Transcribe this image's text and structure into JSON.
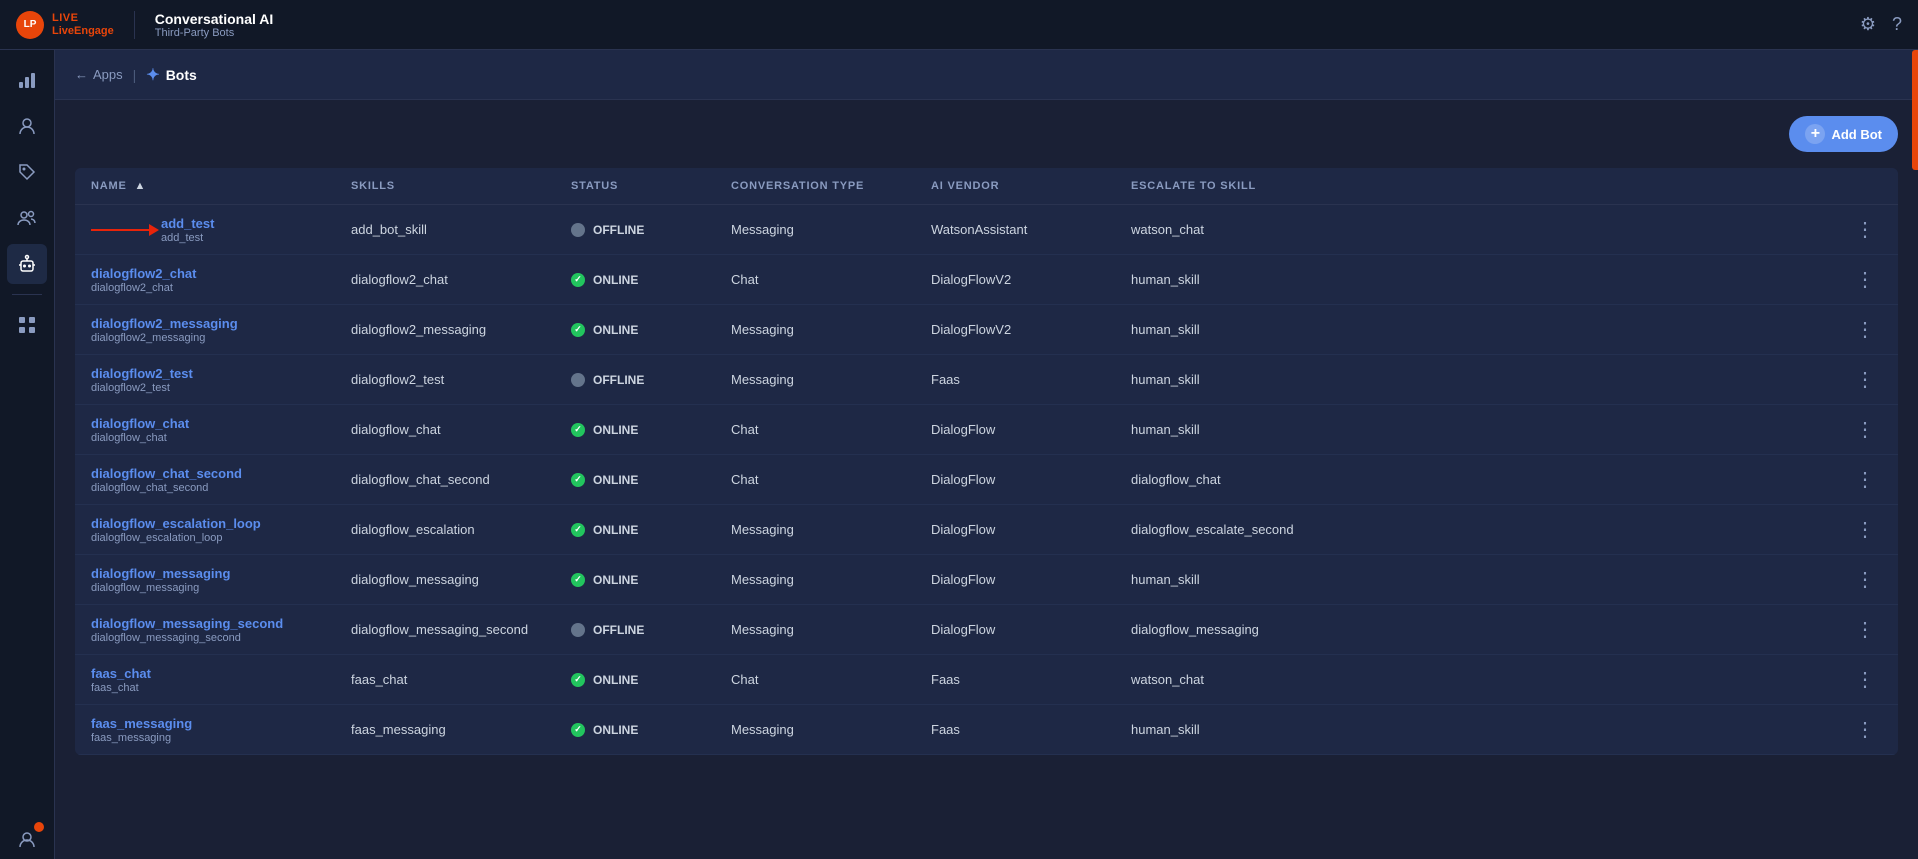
{
  "header": {
    "logo_live": "LIVE",
    "logo_engage": "LiveEngage",
    "main_title": "Conversational AI",
    "sub_title": "Third-Party Bots",
    "settings_icon": "⚙",
    "help_icon": "?"
  },
  "breadcrumb": {
    "apps_label": "Apps",
    "bots_label": "Bots"
  },
  "toolbar": {
    "add_bot_label": "Add Bot"
  },
  "table": {
    "columns": {
      "name": "NAME",
      "skills": "SKILLS",
      "status": "STATUS",
      "conversation_type": "CONVERSATION TYPE",
      "ai_vendor": "AI VENDOR",
      "escalate_to_skill": "ESCALATE TO SKILL"
    },
    "rows": [
      {
        "name": "add_test",
        "name_sub": "add_test",
        "skills": "add_bot_skill",
        "status": "OFFLINE",
        "status_type": "offline",
        "conversation_type": "Messaging",
        "ai_vendor": "WatsonAssistant",
        "escalate_to_skill": "watson_chat",
        "has_arrow": true
      },
      {
        "name": "dialogflow2_chat",
        "name_sub": "dialogflow2_chat",
        "skills": "dialogflow2_chat",
        "status": "ONLINE",
        "status_type": "online",
        "conversation_type": "Chat",
        "ai_vendor": "DialogFlowV2",
        "escalate_to_skill": "human_skill",
        "has_arrow": false
      },
      {
        "name": "dialogflow2_messaging",
        "name_sub": "dialogflow2_messaging",
        "skills": "dialogflow2_messaging",
        "status": "ONLINE",
        "status_type": "online",
        "conversation_type": "Messaging",
        "ai_vendor": "DialogFlowV2",
        "escalate_to_skill": "human_skill",
        "has_arrow": false
      },
      {
        "name": "dialogflow2_test",
        "name_sub": "dialogflow2_test",
        "skills": "dialogflow2_test",
        "status": "OFFLINE",
        "status_type": "offline",
        "conversation_type": "Messaging",
        "ai_vendor": "Faas",
        "escalate_to_skill": "human_skill",
        "has_arrow": false
      },
      {
        "name": "dialogflow_chat",
        "name_sub": "dialogflow_chat",
        "skills": "dialogflow_chat",
        "status": "ONLINE",
        "status_type": "online",
        "conversation_type": "Chat",
        "ai_vendor": "DialogFlow",
        "escalate_to_skill": "human_skill",
        "has_arrow": false
      },
      {
        "name": "dialogflow_chat_second",
        "name_sub": "dialogflow_chat_second",
        "skills": "dialogflow_chat_second",
        "status": "ONLINE",
        "status_type": "online",
        "conversation_type": "Chat",
        "ai_vendor": "DialogFlow",
        "escalate_to_skill": "dialogflow_chat",
        "has_arrow": false
      },
      {
        "name": "dialogflow_escalation_loop",
        "name_sub": "dialogflow_escalation_loop",
        "skills": "dialogflow_escalation",
        "status": "ONLINE",
        "status_type": "online",
        "conversation_type": "Messaging",
        "ai_vendor": "DialogFlow",
        "escalate_to_skill": "dialogflow_escalate_second",
        "has_arrow": false
      },
      {
        "name": "dialogflow_messaging",
        "name_sub": "dialogflow_messaging",
        "skills": "dialogflow_messaging",
        "status": "ONLINE",
        "status_type": "online",
        "conversation_type": "Messaging",
        "ai_vendor": "DialogFlow",
        "escalate_to_skill": "human_skill",
        "has_arrow": false
      },
      {
        "name": "dialogflow_messaging_second",
        "name_sub": "dialogflow_messaging_second",
        "skills": "dialogflow_messaging_second",
        "status": "OFFLINE",
        "status_type": "offline",
        "conversation_type": "Messaging",
        "ai_vendor": "DialogFlow",
        "escalate_to_skill": "dialogflow_messaging",
        "has_arrow": false
      },
      {
        "name": "faas_chat",
        "name_sub": "faas_chat",
        "skills": "faas_chat",
        "status": "ONLINE",
        "status_type": "online",
        "conversation_type": "Chat",
        "ai_vendor": "Faas",
        "escalate_to_skill": "watson_chat",
        "has_arrow": false
      },
      {
        "name": "faas_messaging",
        "name_sub": "faas_messaging",
        "skills": "faas_messaging",
        "status": "ONLINE",
        "status_type": "online",
        "conversation_type": "Messaging",
        "ai_vendor": "Faas",
        "escalate_to_skill": "human_skill",
        "has_arrow": false
      }
    ]
  },
  "sidebar": {
    "icons": [
      {
        "name": "bar-chart-icon",
        "symbol": "📊",
        "active": false
      },
      {
        "name": "agent-icon",
        "symbol": "👤",
        "active": false
      },
      {
        "name": "tag-icon",
        "symbol": "🏷",
        "active": false
      },
      {
        "name": "user-icon",
        "symbol": "👥",
        "active": false
      },
      {
        "name": "bot-icon",
        "symbol": "🤖",
        "active": true
      },
      {
        "name": "dots-icon",
        "symbol": "⋯",
        "active": false
      },
      {
        "name": "account-icon",
        "symbol": "👤",
        "active": false,
        "badge": true
      }
    ]
  }
}
